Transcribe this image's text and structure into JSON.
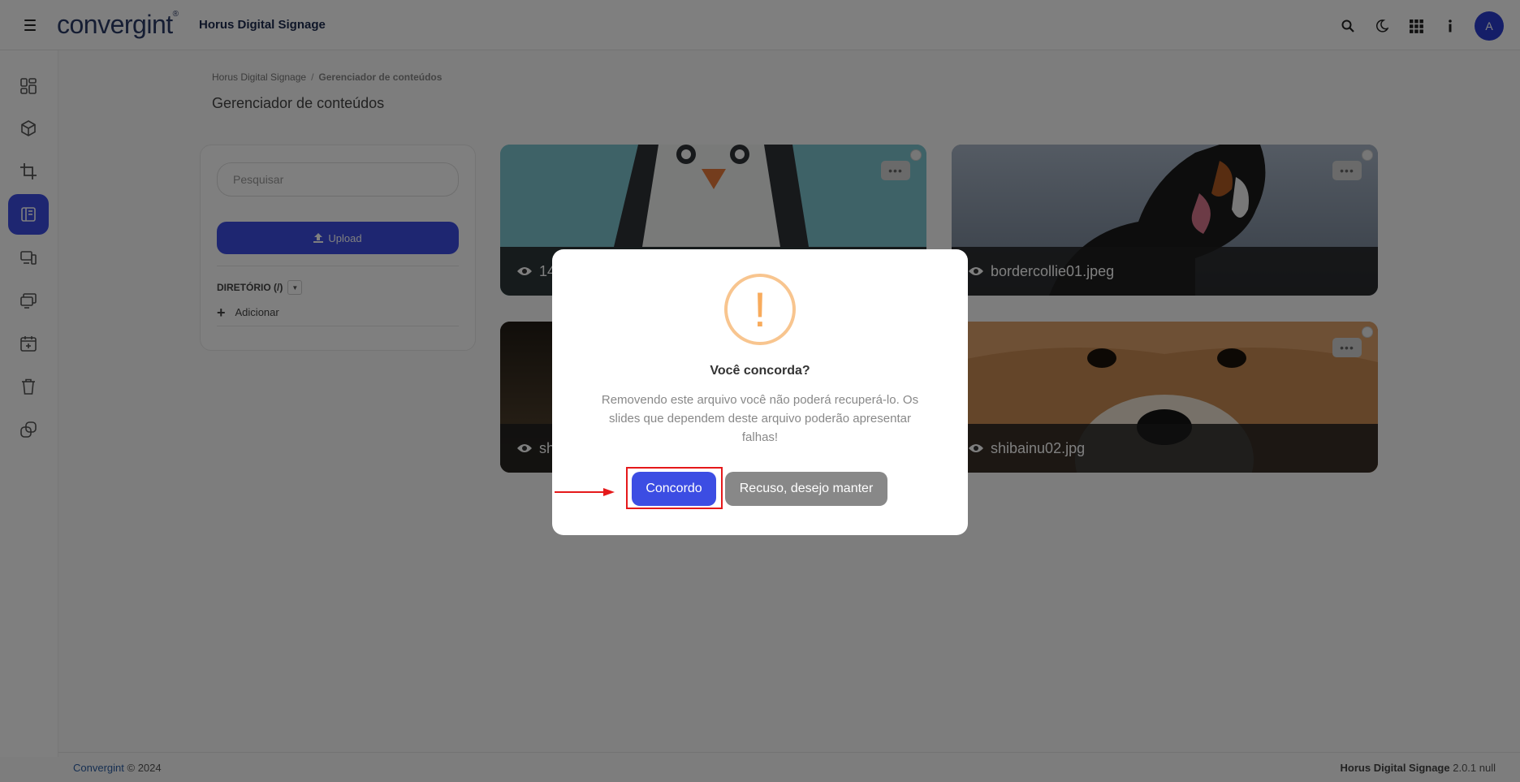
{
  "header": {
    "logo": "convergint",
    "app_title": "Horus Digital Signage"
  },
  "breadcrumb": {
    "root": "Horus Digital Signage",
    "separator": "/",
    "current": "Gerenciador de conteúdos"
  },
  "page_title": "Gerenciador de conteúdos",
  "panel": {
    "search_placeholder": "Pesquisar",
    "upload_label": "Upload",
    "directory_label": "DIRETÓRIO (/)",
    "add_label": "Adicionar"
  },
  "cards": [
    {
      "name": "14",
      "more": "•••"
    },
    {
      "name": "bordercollie01.jpeg",
      "more": "•••"
    },
    {
      "name": "sh",
      "more": "•••"
    },
    {
      "name": "shibainu02.jpg",
      "more": "•••"
    }
  ],
  "dialog": {
    "title": "Você concorda?",
    "message": "Removendo este arquivo você não poderá recuperá-lo. Os slides que dependem deste arquivo poderão apresentar falhas!",
    "confirm_label": "Concordo",
    "cancel_label": "Recuso, desejo manter",
    "icon_glyph": "!"
  },
  "footer": {
    "brand": "Convergint",
    "copyright": "© 2024",
    "product": "Horus Digital Signage",
    "version": "2.0.1 null"
  },
  "colors": {
    "accent": "#3c4de3",
    "warning": "#f8ab5c",
    "highlight": "#e5191b"
  }
}
